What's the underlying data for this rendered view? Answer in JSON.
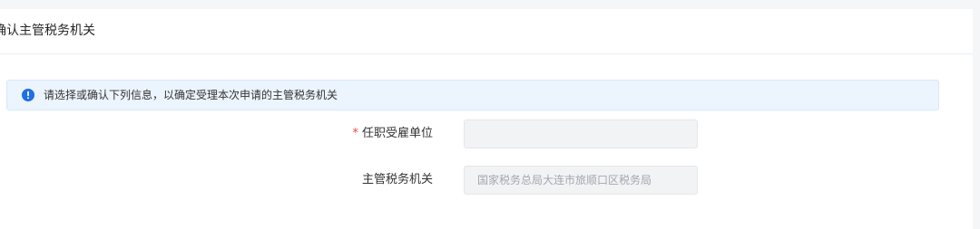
{
  "header": {
    "title": "确认主管税务机关"
  },
  "notice": {
    "icon": "info-icon",
    "icon_color": "#1f6fe5",
    "text": "请选择或确认下列信息，以确定受理本次申请的主管税务机关"
  },
  "form": {
    "employer": {
      "required_mark": "*",
      "label": "任职受雇单位",
      "value": ""
    },
    "tax_authority": {
      "label": "主管税务机关",
      "value": "国家税务总局大连市旅顺口区税务局"
    }
  }
}
